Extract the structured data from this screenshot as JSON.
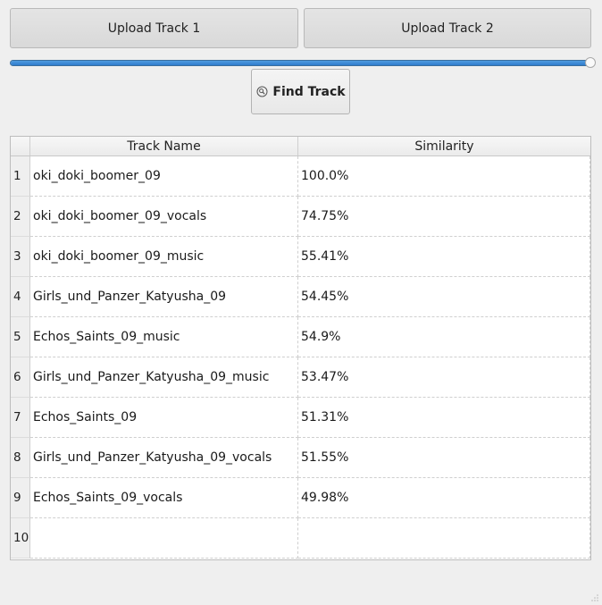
{
  "toolbar": {
    "upload1_label": "Upload Track 1",
    "upload2_label": "Upload Track 2",
    "find_label": "Find Track",
    "find_icon": "search-icon"
  },
  "slider": {
    "value_fraction": 1.0
  },
  "table": {
    "headers": [
      "Track Name",
      "Similarity"
    ],
    "rows": [
      {
        "num": "1",
        "name": "oki_doki_boomer_09",
        "similarity": "100.0%"
      },
      {
        "num": "2",
        "name": "oki_doki_boomer_09_vocals",
        "similarity": "74.75%"
      },
      {
        "num": "3",
        "name": "oki_doki_boomer_09_music",
        "similarity": "55.41%"
      },
      {
        "num": "4",
        "name": "Girls_und_Panzer_Katyusha_09",
        "similarity": "54.45%"
      },
      {
        "num": "5",
        "name": "Echos_Saints_09_music",
        "similarity": "54.9%"
      },
      {
        "num": "6",
        "name": "Girls_und_Panzer_Katyusha_09_music",
        "similarity": "53.47%"
      },
      {
        "num": "7",
        "name": "Echos_Saints_09",
        "similarity": "51.31%"
      },
      {
        "num": "8",
        "name": "Girls_und_Panzer_Katyusha_09_vocals",
        "similarity": "51.55%"
      },
      {
        "num": "9",
        "name": "Echos_Saints_09_vocals",
        "similarity": "49.98%"
      },
      {
        "num": "10",
        "name": "",
        "similarity": ""
      }
    ]
  },
  "colors": {
    "accent": "#2f7ccc",
    "background": "#efefef"
  }
}
